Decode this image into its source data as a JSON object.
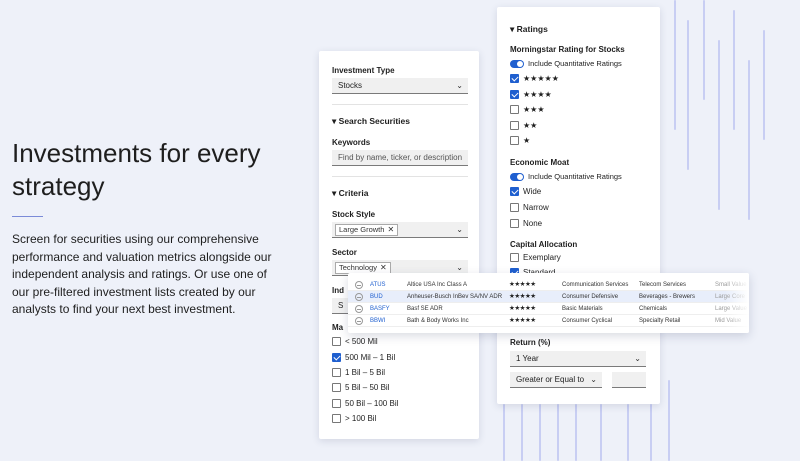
{
  "hero": {
    "title": "Investments for every strategy",
    "body": "Screen for securities using our comprehensive performance and valuation metrics alongside our independent analysis and ratings. Or use one of our pre-filtered investment lists created by our analysts to find your next best investment."
  },
  "left_panel": {
    "investment_type_label": "Investment Type",
    "investment_type_value": "Stocks",
    "search_header": "Search Securities",
    "keywords_label": "Keywords",
    "keywords_placeholder": "Find by name, ticker, or description",
    "criteria_header": "Criteria",
    "stock_style_label": "Stock Style",
    "stock_style_chip": "Large Growth",
    "sector_label": "Sector",
    "sector_chip": "Technology",
    "industry_label_partial": "Ind",
    "industry_value_partial": "S",
    "market_cap_label_partial": "Ma",
    "market_cap_options": [
      {
        "label": "< 500 Mil",
        "checked": false
      },
      {
        "label": "500 Mil – 1 Bil",
        "checked": true
      },
      {
        "label": "1 Bil – 5 Bil",
        "checked": false
      },
      {
        "label": "5 Bil – 50 Bil",
        "checked": false
      },
      {
        "label": "50 Bil – 100 Bil",
        "checked": false
      },
      {
        "label": "> 100 Bil",
        "checked": false
      }
    ]
  },
  "right_panel": {
    "ratings_header": "Ratings",
    "morningstar_label": "Morningstar Rating for Stocks",
    "quant_toggle_label": "Include Quantitative Ratings",
    "star_options": [
      {
        "label": "★★★★★",
        "checked": true
      },
      {
        "label": "★★★★",
        "checked": true
      },
      {
        "label": "★★★",
        "checked": false
      },
      {
        "label": "★★",
        "checked": false
      },
      {
        "label": "★",
        "checked": false
      }
    ],
    "moat_label": "Economic Moat",
    "moat_toggle_label": "Include Quantitative Ratings",
    "moat_options": [
      {
        "label": "Wide",
        "checked": true
      },
      {
        "label": "Narrow",
        "checked": false
      },
      {
        "label": "None",
        "checked": false
      }
    ],
    "capital_label": "Capital Allocation",
    "capital_options": [
      {
        "label": "Exemplary",
        "checked": false
      },
      {
        "label": "Standard",
        "checked": true
      }
    ],
    "return_label": "Return (%)",
    "return_period": "1 Year",
    "return_operator": "Greater or Equal to",
    "return_value": ""
  },
  "results": [
    {
      "ticker": "ATUS",
      "name": "Altice USA Inc Class A",
      "stars": "★★★★★",
      "sector": "Communication Services",
      "industry": "Telecom Services",
      "size": "Small Value"
    },
    {
      "ticker": "BUD",
      "name": "Anheuser-Busch InBev SA/NV ADR",
      "stars": "★★★★★",
      "sector": "Consumer Defensive",
      "industry": "Beverages - Brewers",
      "size": "Large Core"
    },
    {
      "ticker": "BASFY",
      "name": "Basf SE ADR",
      "stars": "★★★★★",
      "sector": "Basic Materials",
      "industry": "Chemicals",
      "size": "Large Value"
    },
    {
      "ticker": "BBWI",
      "name": "Bath & Body Works Inc",
      "stars": "★★★★★",
      "sector": "Consumer Cyclical",
      "industry": "Specialty Retail",
      "size": "Mid Value"
    }
  ],
  "colors": {
    "accent": "#1f5fcf",
    "background": "#eef1f9",
    "line": "#c8cef3"
  }
}
